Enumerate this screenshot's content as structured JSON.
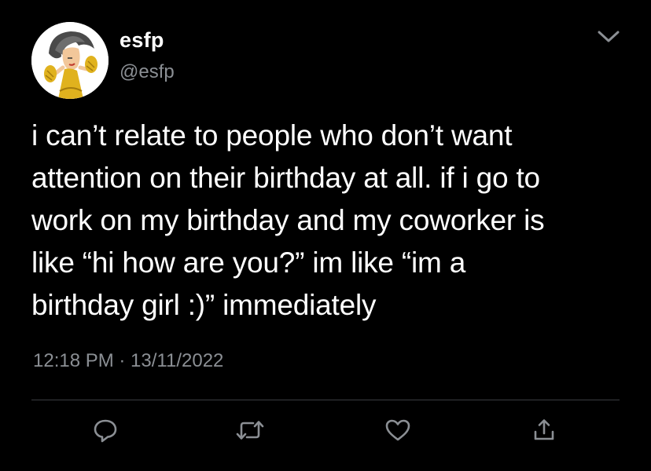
{
  "author": {
    "display_name": "esfp",
    "handle": "@esfp",
    "avatar": "cartoon-dancer-with-maracas-avatar"
  },
  "tweet": {
    "text": "i can’t relate to people who don’t want\nattention on their birthday at all. if i go to\nwork on my birthday and my coworker is\nlike “hi how are you?” im like “im a\nbirthday girl :)” immediately",
    "timestamp": "12:18 PM · 13/11/2022"
  },
  "icons": {
    "menu": "chevron-down-icon",
    "reply": "reply-icon",
    "retweet": "retweet-icon",
    "like": "heart-icon",
    "share": "share-icon"
  },
  "colors": {
    "background": "#000000",
    "text": "#ffffff",
    "secondary_text": "#8b8f94",
    "divider": "#3a3d41",
    "avatar_accent": "#e0b21e"
  }
}
